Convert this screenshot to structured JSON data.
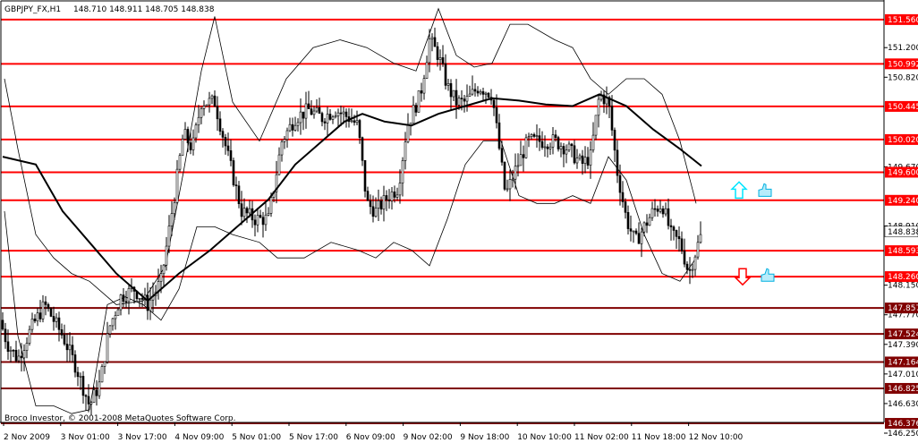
{
  "header": {
    "symbol": "GBPJPY_FX,H1",
    "ohlc": "148.710 148.911 148.705 148.838"
  },
  "footer": {
    "copyright": "Broco Investor, © 2001-2008 MetaQuotes Software Corp."
  },
  "colors": {
    "background": "#ffffff",
    "level_line": "#ff0000",
    "level_box": "#ff0000",
    "level_box_dark": "#800000",
    "candle": "#000000",
    "bands": "#000000",
    "ma": "#000000",
    "up_arrow": "#00e5ff",
    "down_arrow": "#ff0000",
    "thumb": "#00b0e0"
  },
  "icons": {
    "up_arrow": "up-arrow-icon",
    "down_arrow": "down-arrow-icon",
    "thumb": "thumbs-up-icon"
  },
  "chart_data": {
    "type": "candlestick",
    "title": "GBPJPY_FX,H1",
    "y_range": [
      146.25,
      151.8
    ],
    "x_ticks": [
      "2 Nov 2009",
      "3 Nov 01:00",
      "3 Nov 17:00",
      "4 Nov 09:00",
      "5 Nov 01:00",
      "5 Nov 17:00",
      "6 Nov 09:00",
      "9 Nov 02:00",
      "9 Nov 18:00",
      "10 Nov 10:00",
      "11 Nov 02:00",
      "11 Nov 18:00",
      "12 Nov 10:00"
    ],
    "y_ticks": [
      "151.200",
      "150.820",
      "149.670",
      "148.910",
      "148.150",
      "147.770",
      "147.390",
      "147.010",
      "146.630",
      "146.250"
    ],
    "current_price": "148.838",
    "levels": [
      {
        "value": 151.56,
        "label": "151.560"
      },
      {
        "value": 150.992,
        "label": "150.992"
      },
      {
        "value": 150.445,
        "label": "150.445"
      },
      {
        "value": 150.02,
        "label": "150.020"
      },
      {
        "value": 149.6,
        "label": "149.600"
      },
      {
        "value": 149.24,
        "label": "149.240"
      },
      {
        "value": 148.593,
        "label": "148.593"
      },
      {
        "value": 148.26,
        "label": "148.260"
      },
      {
        "value": 147.857,
        "label": "147.857"
      },
      {
        "value": 147.524,
        "label": "147.524"
      },
      {
        "value": 147.164,
        "label": "147.164"
      },
      {
        "value": 146.825,
        "label": "146.825"
      },
      {
        "value": 146.376,
        "label": "146.376"
      }
    ],
    "price_path": [
      [
        0,
        147.7
      ],
      [
        8,
        147.4
      ],
      [
        20,
        147.2
      ],
      [
        35,
        147.6
      ],
      [
        50,
        147.9
      ],
      [
        70,
        147.5
      ],
      [
        85,
        147.1
      ],
      [
        100,
        146.6
      ],
      [
        112,
        146.9
      ],
      [
        122,
        147.6
      ],
      [
        135,
        148.0
      ],
      [
        150,
        148.1
      ],
      [
        165,
        147.9
      ],
      [
        180,
        148.2
      ],
      [
        195,
        149.3
      ],
      [
        205,
        150.1
      ],
      [
        215,
        149.9
      ],
      [
        225,
        150.5
      ],
      [
        240,
        150.5
      ],
      [
        255,
        149.8
      ],
      [
        270,
        149.1
      ],
      [
        285,
        149.0
      ],
      [
        300,
        149.0
      ],
      [
        315,
        150.0
      ],
      [
        330,
        150.3
      ],
      [
        345,
        150.4
      ],
      [
        360,
        150.3
      ],
      [
        375,
        150.4
      ],
      [
        390,
        150.3
      ],
      [
        400,
        150.2
      ],
      [
        410,
        149.2
      ],
      [
        420,
        149.1
      ],
      [
        435,
        149.3
      ],
      [
        445,
        149.4
      ],
      [
        455,
        150.2
      ],
      [
        470,
        150.6
      ],
      [
        480,
        151.3
      ],
      [
        490,
        151.1
      ],
      [
        500,
        150.7
      ],
      [
        510,
        150.5
      ],
      [
        520,
        150.5
      ],
      [
        535,
        150.7
      ],
      [
        550,
        150.6
      ],
      [
        565,
        149.3
      ],
      [
        575,
        149.6
      ],
      [
        590,
        150.0
      ],
      [
        605,
        150.0
      ],
      [
        620,
        150.0
      ],
      [
        635,
        149.9
      ],
      [
        650,
        149.7
      ],
      [
        660,
        149.8
      ],
      [
        670,
        150.6
      ],
      [
        680,
        150.5
      ],
      [
        690,
        149.6
      ],
      [
        700,
        149.0
      ],
      [
        710,
        148.7
      ],
      [
        720,
        148.9
      ],
      [
        730,
        149.1
      ],
      [
        740,
        149.2
      ],
      [
        750,
        148.8
      ],
      [
        760,
        148.7
      ],
      [
        770,
        148.3
      ],
      [
        778,
        148.6
      ],
      [
        785,
        148.84
      ]
    ],
    "ma_path": [
      [
        3,
        149.8
      ],
      [
        40,
        149.7
      ],
      [
        70,
        149.1
      ],
      [
        100,
        148.7
      ],
      [
        130,
        148.3
      ],
      [
        165,
        147.95
      ],
      [
        200,
        148.3
      ],
      [
        235,
        148.6
      ],
      [
        270,
        148.95
      ],
      [
        300,
        149.25
      ],
      [
        330,
        149.7
      ],
      [
        360,
        150.0
      ],
      [
        385,
        150.25
      ],
      [
        405,
        150.35
      ],
      [
        430,
        150.25
      ],
      [
        460,
        150.2
      ],
      [
        490,
        150.35
      ],
      [
        520,
        150.45
      ],
      [
        550,
        150.55
      ],
      [
        580,
        150.52
      ],
      [
        610,
        150.47
      ],
      [
        640,
        150.45
      ],
      [
        670,
        150.6
      ],
      [
        700,
        150.45
      ],
      [
        730,
        150.15
      ],
      [
        760,
        149.9
      ],
      [
        784,
        149.68
      ]
    ],
    "upper_band": [
      [
        5,
        150.8
      ],
      [
        20,
        149.9
      ],
      [
        40,
        148.8
      ],
      [
        60,
        148.5
      ],
      [
        80,
        148.3
      ],
      [
        100,
        148.2
      ],
      [
        130,
        147.9
      ],
      [
        160,
        147.95
      ],
      [
        185,
        148.4
      ],
      [
        205,
        149.6
      ],
      [
        225,
        150.9
      ],
      [
        240,
        151.6
      ],
      [
        260,
        150.5
      ],
      [
        290,
        150.0
      ],
      [
        320,
        150.8
      ],
      [
        350,
        151.2
      ],
      [
        380,
        151.3
      ],
      [
        410,
        151.2
      ],
      [
        440,
        151.0
      ],
      [
        465,
        150.9
      ],
      [
        490,
        151.7
      ],
      [
        510,
        151.1
      ],
      [
        530,
        150.95
      ],
      [
        550,
        151.0
      ],
      [
        570,
        151.5
      ],
      [
        590,
        151.5
      ],
      [
        620,
        151.3
      ],
      [
        640,
        151.2
      ],
      [
        660,
        150.8
      ],
      [
        680,
        150.6
      ],
      [
        700,
        150.8
      ],
      [
        720,
        150.8
      ],
      [
        740,
        150.6
      ],
      [
        760,
        150.0
      ],
      [
        778,
        149.2
      ]
    ],
    "lower_band": [
      [
        5,
        149.1
      ],
      [
        20,
        147.5
      ],
      [
        40,
        146.6
      ],
      [
        60,
        146.6
      ],
      [
        80,
        146.5
      ],
      [
        100,
        146.55
      ],
      [
        120,
        147.9
      ],
      [
        140,
        148.0
      ],
      [
        160,
        147.9
      ],
      [
        180,
        147.7
      ],
      [
        200,
        148.1
      ],
      [
        220,
        148.9
      ],
      [
        240,
        148.9
      ],
      [
        260,
        148.8
      ],
      [
        290,
        148.7
      ],
      [
        310,
        148.5
      ],
      [
        340,
        148.5
      ],
      [
        370,
        148.7
      ],
      [
        400,
        148.6
      ],
      [
        420,
        148.5
      ],
      [
        440,
        148.7
      ],
      [
        460,
        148.6
      ],
      [
        480,
        148.4
      ],
      [
        500,
        149.0
      ],
      [
        520,
        149.7
      ],
      [
        540,
        150.0
      ],
      [
        560,
        150.0
      ],
      [
        580,
        149.3
      ],
      [
        600,
        149.2
      ],
      [
        620,
        149.2
      ],
      [
        640,
        149.3
      ],
      [
        660,
        149.2
      ],
      [
        680,
        149.8
      ],
      [
        700,
        149.5
      ],
      [
        720,
        148.8
      ],
      [
        740,
        148.3
      ],
      [
        760,
        148.2
      ],
      [
        778,
        148.5
      ]
    ],
    "signals": [
      {
        "type": "buy",
        "y": 149.36
      },
      {
        "type": "sell",
        "y": 148.27
      }
    ]
  }
}
